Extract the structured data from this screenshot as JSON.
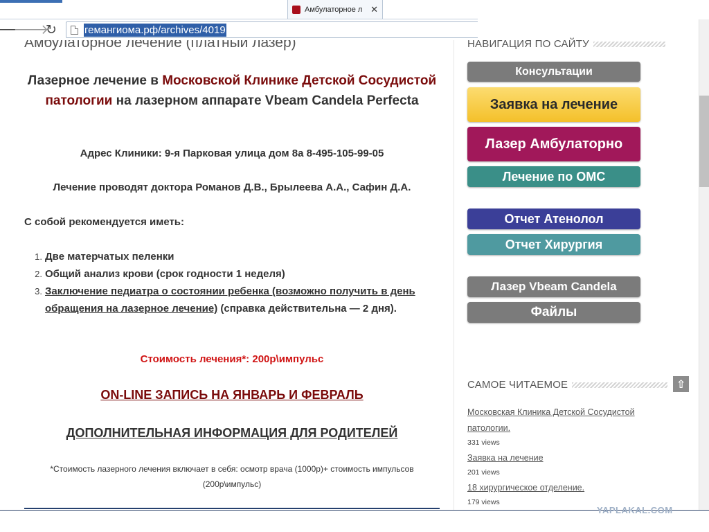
{
  "browser": {
    "tab_title": "Амбулаторное л",
    "tab_close": "✕",
    "url": "гемангиома.рф/archives/4019",
    "back_glyph": "🡐",
    "forward_glyph": "🡒",
    "reload_glyph": "↻"
  },
  "article": {
    "heading": "Амбулаторное лечение (платный лазер)",
    "intro_1": "Лазерное лечение в ",
    "intro_clinic": "Московской Клинике Детской Сосудистой патологии",
    "intro_2": "  на лазерном аппарате Vbeam Candela Perfecta",
    "address": "Адрес Клиники: 9-я Парковая улица дом 8а  8-495-105-99-05",
    "doctors": "Лечение проводят доктора Романов Д.В., Брылеева А.А., Сафин Д.А.",
    "recommend_title": "С собой рекомендуется иметь:",
    "list": [
      {
        "num": "1.",
        "text": "Две матерчатых пеленки"
      },
      {
        "num": "2.",
        "text": "Общий анализ крови (срок годности 1 неделя)"
      },
      {
        "num": "3.",
        "text_link": "Заключение педиатра о состоянии ребенка (возможно получить в день обращения на лазерное лечение)",
        "text_rest": " (справка действительна — 2 дня)."
      }
    ],
    "price": "Стоимость лечения*:  200р\\импульс",
    "online_link": "ON-LINE ЗАПИСЬ НА ЯНВАРЬ И ФЕВРАЛЬ",
    "info_link": "ДОПОЛНИТЕЛЬНАЯ ИНФОРМАЦИЯ ДЛЯ РОДИТЕЛЕЙ",
    "footnote": "*Стоимость лазерного лечения включает в себя: осмотр врача (1000р)+ стоимость импульсов (200р\\импульс)"
  },
  "sidebar": {
    "nav_title": "НАВИГАЦИЯ ПО САЙТУ",
    "buttons": [
      {
        "label": "Консультации",
        "color": "#7b7b7b"
      },
      {
        "label": "Заявка на лечение",
        "color": "#f7c532"
      },
      {
        "label": "Лазер Амбулаторно",
        "color": "#a1185a"
      },
      {
        "label": "Лечение по ОМС",
        "color": "#3a8f88"
      },
      {
        "label": "Отчет Атенолол",
        "color": "#3b3f98"
      },
      {
        "label": "Отчет Хирургия",
        "color": "#4f9aa0"
      },
      {
        "label": "Лазер Vbeam Candela",
        "color": "#7b7b7b"
      },
      {
        "label": "Файлы",
        "color": "#7b7b7b"
      }
    ],
    "popular_title": "САМОЕ ЧИТАЕМОЕ",
    "popular": [
      {
        "title": "Московская Клиника Детской Сосудистой патологии.",
        "views": "331 views"
      },
      {
        "title": "Заявка на лечение",
        "views": "201 views"
      },
      {
        "title": "18 хирургическое отделение.",
        "views": "179 views"
      }
    ],
    "scroll_top_glyph": "⇧"
  },
  "watermark": "YAPLAKAL.COM"
}
